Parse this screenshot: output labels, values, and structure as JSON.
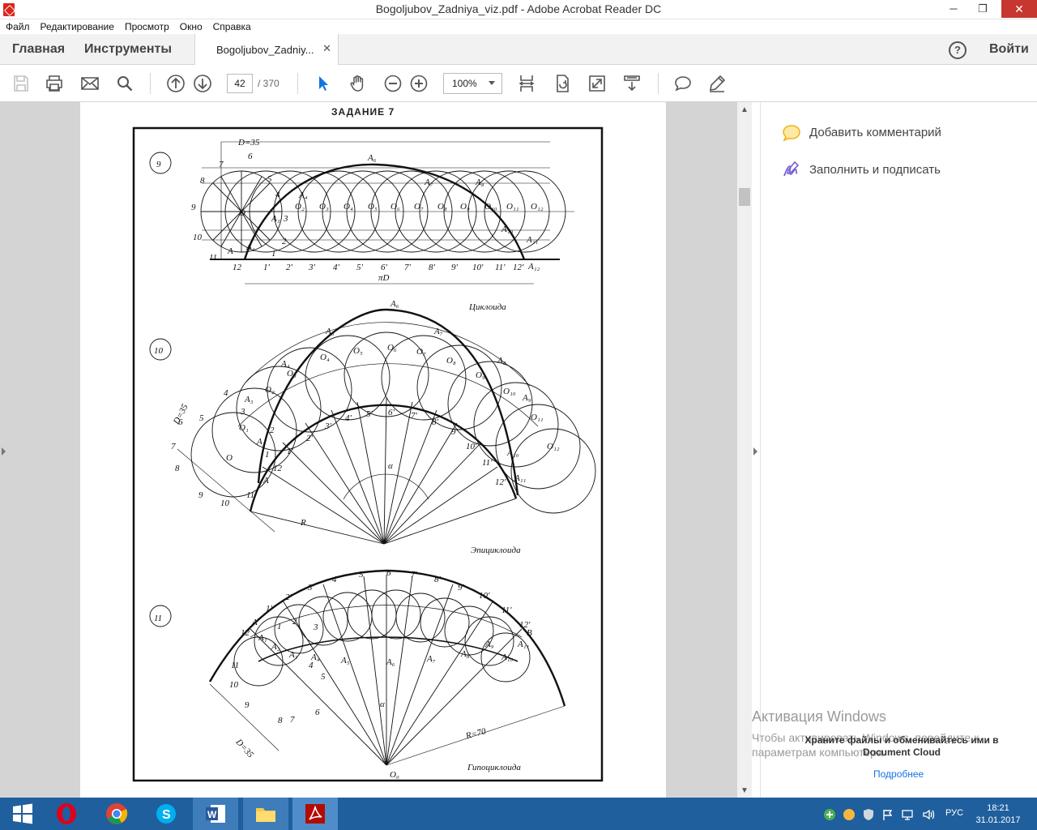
{
  "window": {
    "title": "Bogoljubov_Zadniya_viz.pdf - Adobe Acrobat Reader DC",
    "minimize": "─",
    "maximize": "❐",
    "close": "✕"
  },
  "menu": [
    "Файл",
    "Редактирование",
    "Просмотр",
    "Окно",
    "Справка"
  ],
  "nav": {
    "home": "Главная",
    "tools": "Инструменты",
    "doc_tab": "Bogoljubov_Zadniy...",
    "close_tab": "✕",
    "help": "?",
    "signin": "Войти"
  },
  "toolbar": {
    "page_current": "42",
    "page_total": "/ 370",
    "zoom": "100%"
  },
  "document": {
    "heading": "ЗАДАНИЕ 7",
    "fig9": {
      "number": "9",
      "dim_d": "D=35",
      "dim_pid": "πD",
      "label_caption": "Циклоида",
      "centers": [
        "O",
        "O₂",
        "O₃",
        "O₄",
        "O₅",
        "O₆",
        "O₇",
        "O₈",
        "O₉",
        "O₁₀",
        "O₁₁",
        "O₁₂"
      ],
      "base": [
        "12",
        "1'",
        "2'",
        "3'",
        "4'",
        "5'",
        "6'",
        "7'",
        "8'",
        "9'",
        "10'",
        "11'",
        "12'"
      ],
      "points": [
        "A",
        "A₁",
        "A₃",
        "A₄",
        "A₆",
        "A₇",
        "A₈",
        "A₁₀",
        "A₁₁",
        "A₁₂"
      ],
      "circle_marks": [
        "6",
        "7",
        "8",
        "9",
        "10",
        "11",
        "5",
        "4",
        "3",
        "2",
        "1"
      ]
    },
    "fig10": {
      "number": "10",
      "dim_d": "D=35",
      "radius": "R",
      "angle": "α",
      "label_caption": "Эпициклоида",
      "points_top": [
        "A₅",
        "A₆",
        "A₇",
        "A₈",
        "A₉",
        "A₁₀",
        "A₁₁",
        "A₄",
        "A₃",
        "A₂",
        "A"
      ],
      "centers": [
        "O₁",
        "O₂",
        "O₃",
        "O₄",
        "O₅",
        "O₆",
        "O₇",
        "O₈",
        "O₉",
        "O₁₀",
        "O₁₁",
        "O₁₂"
      ],
      "base": [
        "1'",
        "2'",
        "3'",
        "4'",
        "5'",
        "6'",
        "7'",
        "8'",
        "9'",
        "10'",
        "11'",
        "12'"
      ],
      "circle_marks": [
        "4",
        "5",
        "6",
        "7",
        "8",
        "9",
        "10",
        "11",
        "12",
        "3",
        "2",
        "1",
        "O"
      ]
    },
    "fig11": {
      "number": "11",
      "dim_d": "D=35",
      "radius": "R=70",
      "angle": "α",
      "center": "O₀",
      "label_caption": "Гипоциклоида",
      "arc_top": [
        "1'",
        "2'",
        "3'",
        "4'",
        "5'",
        "6'",
        "7'",
        "8'",
        "9'",
        "10'",
        "11'",
        "12'"
      ],
      "points": [
        "A",
        "B",
        "A₁",
        "A₂",
        "A₃",
        "A₄",
        "A₅",
        "A₆",
        "A₇",
        "A₈",
        "A₉",
        "A₁₀",
        "A₁₁"
      ],
      "left_marks": [
        "12",
        "11",
        "10",
        "9",
        "8",
        "7",
        "6",
        "5",
        "4",
        "3",
        "2",
        "1"
      ]
    }
  },
  "right_pane": {
    "add_comment": "Добавить комментарий",
    "fill_sign": "Заполнить и подписать",
    "activation_title": "Активация Windows",
    "activation_text_1": "Чтобы активировать Windows, перейдите к",
    "activation_text_2": "параметрам компьютера.",
    "cloud_text_1": "Храните файлы и обменивайтесь ими в",
    "cloud_text_2": "Document Cloud",
    "cloud_link": "Подробнее"
  },
  "taskbar": {
    "lang": "РУС",
    "time": "18:21",
    "date": "31.01.2017"
  }
}
